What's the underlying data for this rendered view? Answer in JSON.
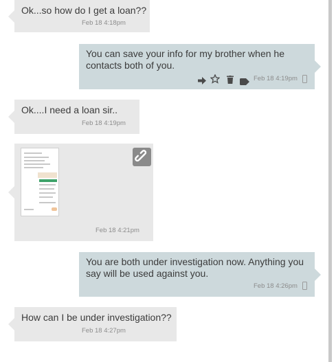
{
  "messages": [
    {
      "id": "m1",
      "direction": "incoming",
      "text": "Ok...so how do I get a loan??",
      "timestamp": "Feb 18 4:18pm"
    },
    {
      "id": "m2",
      "direction": "outgoing",
      "lines": [
        "You can save your info for my brother when he",
        "contacts both of you."
      ],
      "timestamp": "Feb 18 4:19pm",
      "actions": [
        "forward-icon",
        "star-icon",
        "trash-icon",
        "tag-icon"
      ],
      "channel_icon": "phone-icon"
    },
    {
      "id": "m3",
      "direction": "incoming",
      "text": "Ok....I need a loan sir..",
      "timestamp": "Feb 18 4:19pm"
    },
    {
      "id": "m4",
      "direction": "incoming",
      "type": "image",
      "timestamp": "Feb 18 4:21pm",
      "attachment_icon": "link-icon"
    },
    {
      "id": "m5",
      "direction": "outgoing",
      "lines": [
        "You are both under investigation now. Anything you",
        "say will be used against you."
      ],
      "timestamp": "Feb 18 4:26pm",
      "channel_icon": "phone-icon"
    },
    {
      "id": "m6",
      "direction": "incoming",
      "text": "How can I be under investigation??",
      "timestamp": "Feb 18 4:27pm"
    }
  ],
  "colors": {
    "incoming_bubble": "#e8e8e8",
    "outgoing_bubble": "#cdd9dc",
    "text": "#3b3b3b",
    "meta": "#8c8c8c",
    "link_button": "#8a8a8a"
  }
}
